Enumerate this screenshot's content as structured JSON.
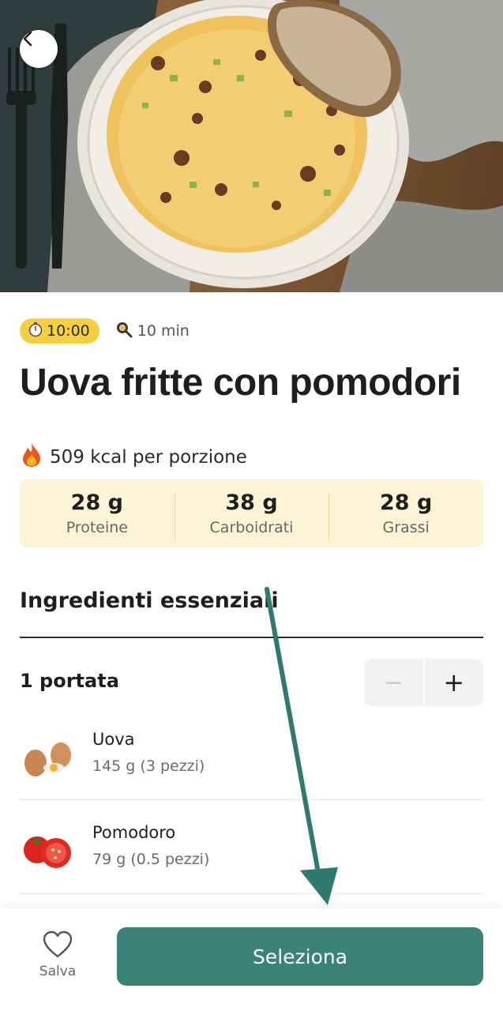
{
  "recipe": {
    "time_badge": "10:00",
    "prep_time": "10 min",
    "title": "Uova fritte con pomodori",
    "kcal": "509 kcal per porzione"
  },
  "macros": [
    {
      "value": "28 g",
      "label": "Proteine"
    },
    {
      "value": "38 g",
      "label": "Carboidrati"
    },
    {
      "value": "28 g",
      "label": "Grassi"
    }
  ],
  "ingredients_section": {
    "title": "Ingredienti essenziali",
    "servings": "1 portata",
    "minus": "−",
    "plus": "+",
    "items": [
      {
        "name": "Uova",
        "qty": "145 g (3 pezzi)"
      },
      {
        "name": "Pomodoro",
        "qty": "79 g (0.5 pezzi)"
      }
    ]
  },
  "bottom_bar": {
    "save_label": "Salva",
    "select_label": "Seleziona"
  },
  "icons": {
    "back": "chevron-left-icon",
    "timer": "stopwatch-icon",
    "prep": "frying-pan-icon",
    "kcal": "fire-icon",
    "save": "heart-icon"
  },
  "colors": {
    "accent": "#3a8276",
    "time_badge": "#f5cf3e",
    "macros_bg": "#fdf4d6"
  }
}
